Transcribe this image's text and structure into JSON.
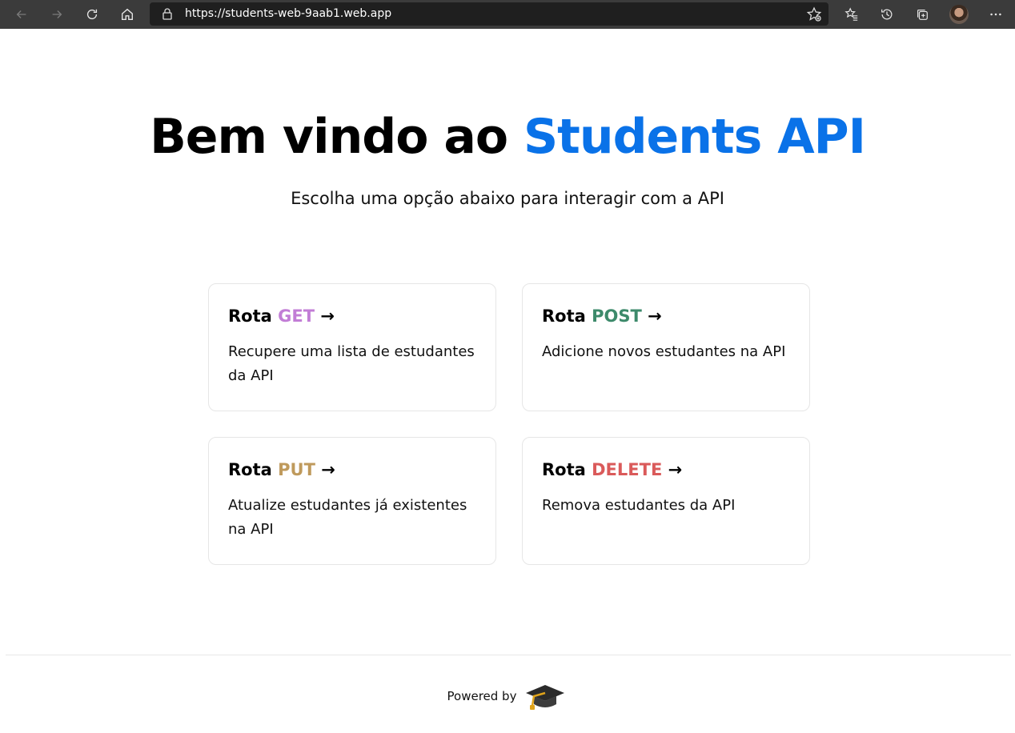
{
  "browser": {
    "url": "https://students-web-9aab1.web.app",
    "icons": [
      "back-icon",
      "forward-icon",
      "refresh-icon",
      "home-icon",
      "lock-icon",
      "add-favorite-icon",
      "favorites-icon",
      "history-icon",
      "collections-icon",
      "profile-avatar",
      "more-icon"
    ]
  },
  "hero": {
    "title_prefix": "Bem vindo ao ",
    "title_accent": "Students API",
    "subtitle": "Escolha uma opção abaixo para interagir com a API",
    "accent_color": "#0a72e8"
  },
  "cards": [
    {
      "prefix": "Rota ",
      "method": "GET",
      "arrow": " →",
      "description": "Recupere uma lista de estudantes da API",
      "method_color": "#c27dd6"
    },
    {
      "prefix": "Rota ",
      "method": "POST",
      "arrow": " →",
      "description": "Adicione novos estudantes na API",
      "method_color": "#3d8a6b"
    },
    {
      "prefix": "Rota ",
      "method": "PUT",
      "arrow": " →",
      "description": "Atualize estudantes já existentes na API",
      "method_color": "#bf9a5c"
    },
    {
      "prefix": "Rota ",
      "method": "DELETE",
      "arrow": " →",
      "description": "Remova estudantes da API",
      "method_color": "#da5a5a"
    }
  ],
  "footer": {
    "text": "Powered by",
    "logo_icon": "graduation-cap-icon"
  }
}
